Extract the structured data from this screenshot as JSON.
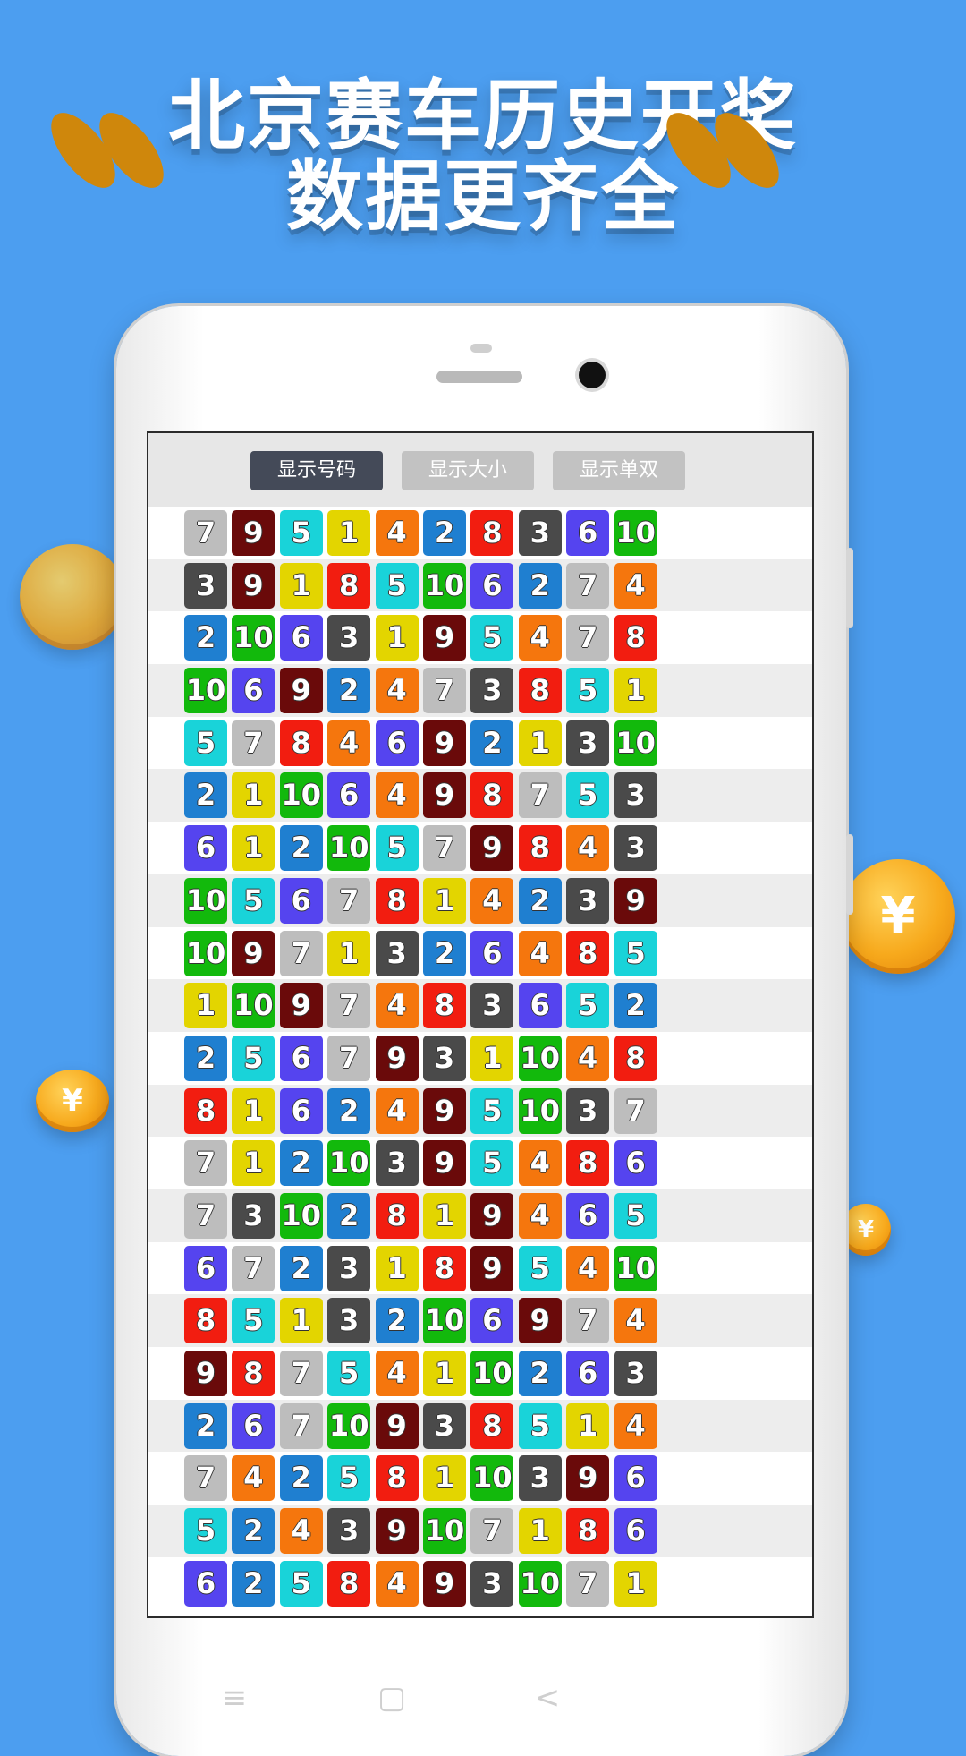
{
  "headline": {
    "line1": "北京赛车历史开奖",
    "line2": "数据更齐全"
  },
  "tabs": [
    {
      "label": "显示号码",
      "active": true
    },
    {
      "label": "显示大小",
      "active": false
    },
    {
      "label": "显示单双",
      "active": false
    }
  ],
  "colors": {
    "background": "#4c9ef0",
    "n1": "#e3d500",
    "n2": "#1f7fd0",
    "n3": "#4a4a4a",
    "n4": "#f5760d",
    "n5": "#19d3d9",
    "n6": "#5544ef",
    "n7": "#bdbdbd",
    "n8": "#f21d10",
    "n9": "#6a0a0a",
    "n10": "#12b90c"
  },
  "draw_rows": [
    [
      7,
      9,
      5,
      1,
      4,
      2,
      8,
      3,
      6,
      10
    ],
    [
      3,
      9,
      1,
      8,
      5,
      10,
      6,
      2,
      7,
      4
    ],
    [
      2,
      10,
      6,
      3,
      1,
      9,
      5,
      4,
      7,
      8
    ],
    [
      10,
      6,
      9,
      2,
      4,
      7,
      3,
      8,
      5,
      1
    ],
    [
      5,
      7,
      8,
      4,
      6,
      9,
      2,
      1,
      3,
      10
    ],
    [
      2,
      1,
      10,
      6,
      4,
      9,
      8,
      7,
      5,
      3
    ],
    [
      6,
      1,
      2,
      10,
      5,
      7,
      9,
      8,
      4,
      3
    ],
    [
      10,
      5,
      6,
      7,
      8,
      1,
      4,
      2,
      3,
      9
    ],
    [
      10,
      9,
      7,
      1,
      3,
      2,
      6,
      4,
      8,
      5
    ],
    [
      1,
      10,
      9,
      7,
      4,
      8,
      3,
      6,
      5,
      2
    ],
    [
      2,
      5,
      6,
      7,
      9,
      3,
      1,
      10,
      4,
      8
    ],
    [
      8,
      1,
      6,
      2,
      4,
      9,
      5,
      10,
      3,
      7
    ],
    [
      7,
      1,
      2,
      10,
      3,
      9,
      5,
      4,
      8,
      6
    ],
    [
      7,
      3,
      10,
      2,
      8,
      1,
      9,
      4,
      6,
      5
    ],
    [
      6,
      7,
      2,
      3,
      1,
      8,
      9,
      5,
      4,
      10
    ],
    [
      8,
      5,
      1,
      3,
      2,
      10,
      6,
      9,
      7,
      4
    ],
    [
      9,
      8,
      7,
      5,
      4,
      1,
      10,
      2,
      6,
      3
    ],
    [
      2,
      6,
      7,
      10,
      9,
      3,
      8,
      5,
      1,
      4
    ],
    [
      7,
      4,
      2,
      5,
      8,
      1,
      10,
      3,
      9,
      6
    ],
    [
      5,
      2,
      4,
      3,
      9,
      10,
      7,
      1,
      8,
      6
    ],
    [
      6,
      2,
      5,
      8,
      4,
      9,
      3,
      10,
      7,
      1
    ]
  ],
  "coin_symbol": "¥",
  "nav": {
    "menu_icon": "≡",
    "home_icon": "▢",
    "back_icon": "<"
  }
}
